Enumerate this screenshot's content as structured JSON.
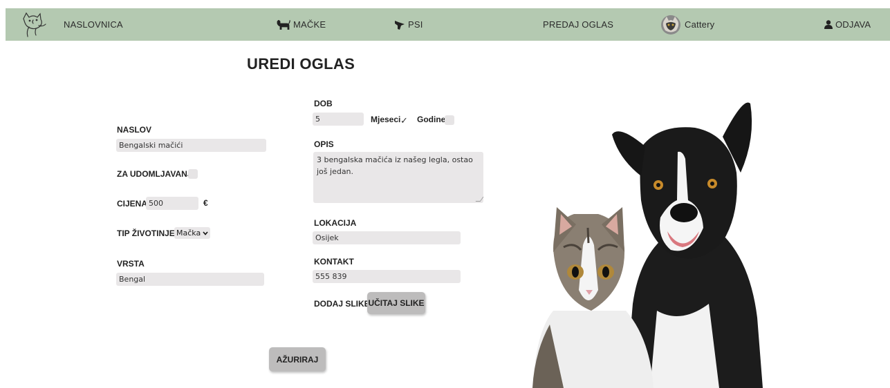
{
  "nav": {
    "home": "NASLOVNICA",
    "cats": "MAČKE",
    "dogs": "PSI",
    "sell": "PREDAJ OGLAS",
    "cattery": "Cattery",
    "logout": "ODJAVA"
  },
  "page_title": "UREDI OGLAS",
  "form": {
    "naslov_label": "NASLOV",
    "naslov_value": "Bengalski mačići",
    "udomljavanje_label": "ZA UDOMLJAVANJE",
    "udomljavanje_checked": false,
    "cijena_label": "CIJENA",
    "cijena_value": "500",
    "currency": "€",
    "tip_label": "TIP ŽIVOTINJE",
    "tip_value": "Mačka",
    "vrsta_label": "VRSTA",
    "vrsta_value": "Bengal",
    "dob_label": "DOB",
    "dob_value": "5",
    "mjeseci_label": "Mjeseci",
    "mjeseci_checked": true,
    "godine_label": "Godine",
    "godine_checked": false,
    "opis_label": "OPIS",
    "opis_value": "3 bengalska mačića iz našeg legla, ostao još jedan.",
    "lokacija_label": "LOKACIJA",
    "lokacija_value": "Osijek",
    "kontakt_label": "KONTAKT",
    "kontakt_value": "555 839",
    "slike_label": "DODAJ SLIKE",
    "upload_button": "UČITAJ SLIKE",
    "submit_button": "AŽURIRAJ"
  },
  "colors": {
    "navbar": "#b4c9b1",
    "input_bg": "#e9e7e8",
    "button_bg": "#bdbcbc"
  }
}
